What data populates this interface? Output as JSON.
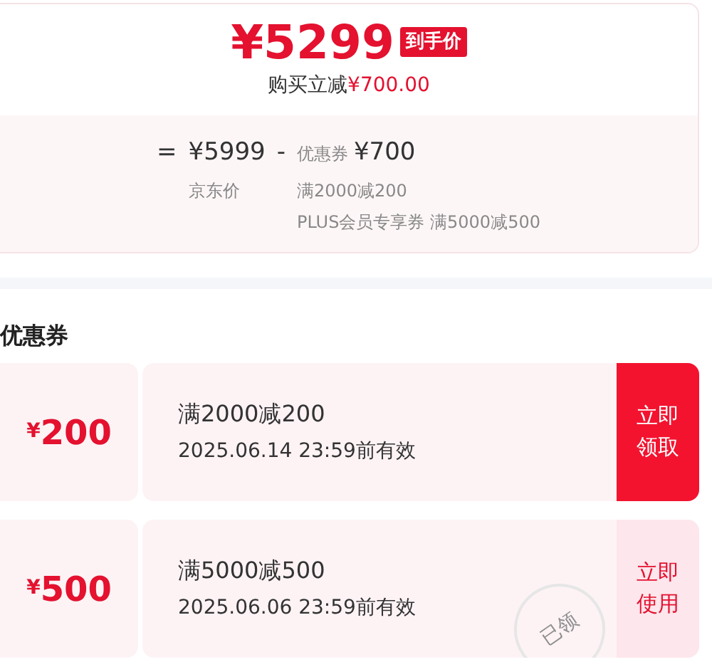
{
  "price_summary": {
    "final_price": "¥5299",
    "final_badge": "到手价",
    "saving_label": "购买立减",
    "saving_amount": "¥700.00",
    "formula": {
      "equals": "=",
      "base_price": "¥5999",
      "base_label": "京东价",
      "minus": "-",
      "discount_label": "优惠券",
      "discount_amount": "¥700",
      "discount_details": [
        "满2000减200",
        "PLUS会员专享券 满5000减500"
      ]
    }
  },
  "coupons_section": {
    "title": "优惠券",
    "coupons": [
      {
        "amount_symbol": "¥",
        "amount": "200",
        "condition": "满2000减200",
        "validity": "2025.06.14 23:59前有效",
        "claimed": false,
        "action": [
          "立即",
          "领取"
        ]
      },
      {
        "amount_symbol": "¥",
        "amount": "500",
        "condition": "满5000减500",
        "validity": "2025.06.06 23:59前有效",
        "claimed": true,
        "stamp": "已领",
        "action": [
          "立即",
          "使用"
        ]
      }
    ]
  }
}
